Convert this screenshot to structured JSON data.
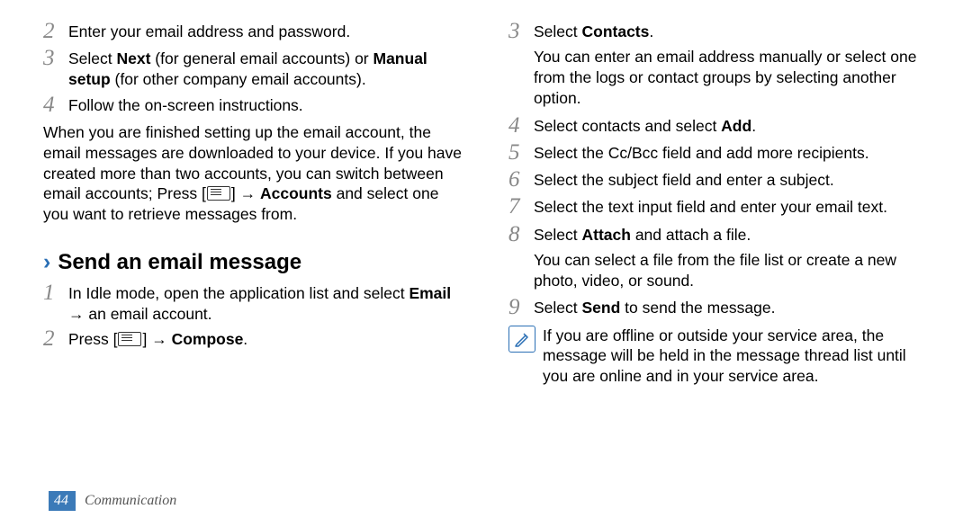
{
  "left": {
    "step2": "Enter your email address and password.",
    "step3_a": "Select ",
    "step3_b": "Next",
    "step3_c": " (for general email accounts) or ",
    "step3_d": "Manual setup",
    "step3_e": " (for other company email accounts).",
    "step4": "Follow the on-screen instructions.",
    "para_a": "When you are finished setting up the email account, the email messages are downloaded to your device. If you have created more than two accounts, you can switch between email accounts; Press [",
    "para_b": "] → ",
    "para_c": "Accounts",
    "para_d": " and select one you want to retrieve messages from.",
    "heading": "Send an email message",
    "s1_a": "In Idle mode, open the application list and select ",
    "s1_b": "Email",
    "s1_c": " → an email account.",
    "s2_a": "Press [",
    "s2_b": "] → ",
    "s2_c": "Compose",
    "s2_d": "."
  },
  "right": {
    "s3_a": "Select ",
    "s3_b": "Contacts",
    "s3_c": ".",
    "s3_sub": "You can enter an email address manually or select one from the logs or contact groups by selecting another option.",
    "s4_a": "Select contacts and select ",
    "s4_b": "Add",
    "s4_c": ".",
    "s5": "Select the Cc/Bcc field and add more recipients.",
    "s6": "Select the subject field and enter a subject.",
    "s7": "Select the text input field and enter your email text.",
    "s8_a": "Select ",
    "s8_b": "Attach",
    "s8_c": " and attach a file.",
    "s8_sub": "You can select a file from the file list or create a new photo, video, or sound.",
    "s9_a": "Select ",
    "s9_b": "Send",
    "s9_c": " to send the message.",
    "note": "If you are offline or outside your service area, the message will be held in the message thread list until you are online and in your service area."
  },
  "nums": {
    "n1": "1",
    "n2": "2",
    "n3": "3",
    "n4": "4",
    "n5": "5",
    "n6": "6",
    "n7": "7",
    "n8": "8",
    "n9": "9"
  },
  "footer": {
    "page": "44",
    "section": "Communication"
  }
}
